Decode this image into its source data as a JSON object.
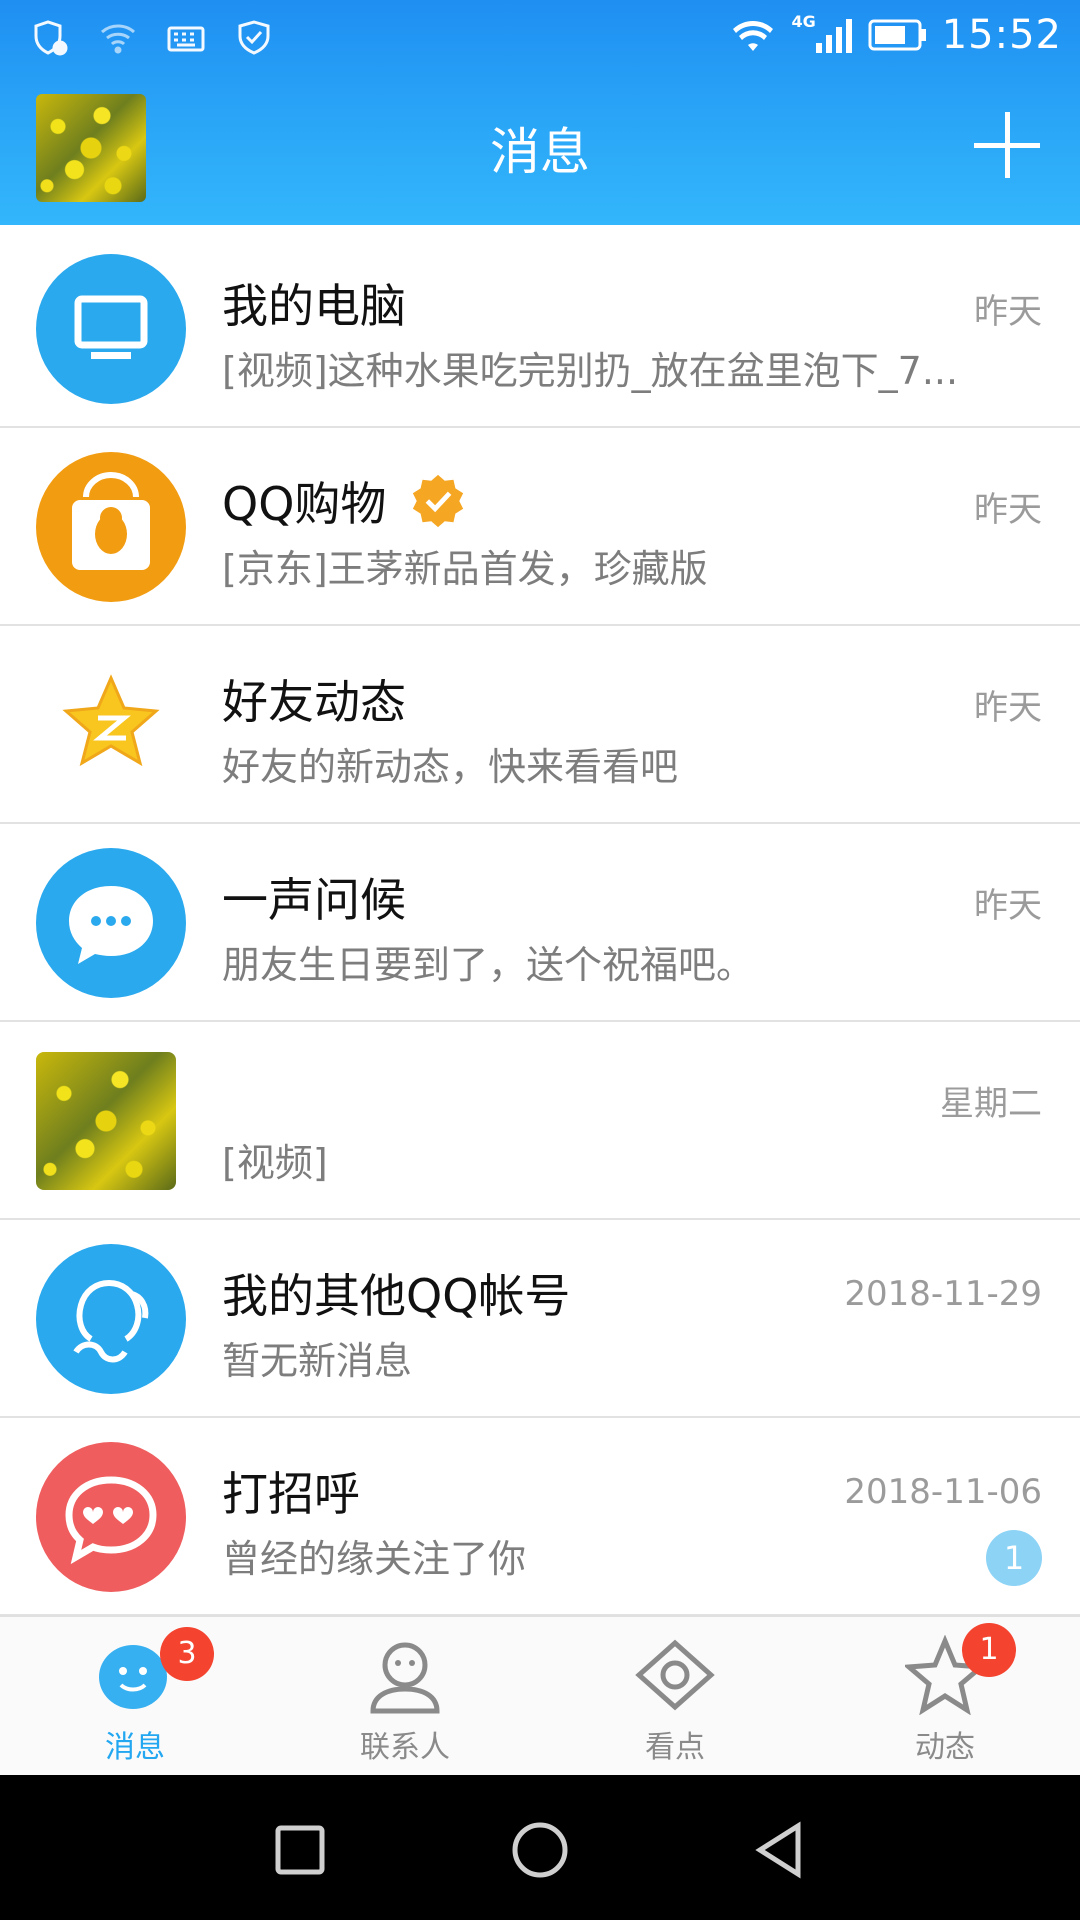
{
  "status_bar": {
    "time": "15:52",
    "network": "4G",
    "icons": [
      "shield-alert-icon",
      "wifi-question-icon",
      "keyboard-icon",
      "shield-check-icon",
      "wifi-icon",
      "signal-icon",
      "battery-icon"
    ]
  },
  "header": {
    "title": "消息",
    "add_icon": "plus-icon"
  },
  "conversations": [
    {
      "name": "我的电脑",
      "message": "[视频]这种水果吃完别扔_放在盆里泡下_7...",
      "time": "昨天",
      "icon": "monitor-icon",
      "color": "#2aa9ee"
    },
    {
      "name": "QQ购物",
      "message": "[京东]王茅新品首发，珍藏版",
      "time": "昨天",
      "icon": "shopping-bag-penguin-icon",
      "color": "#f29c11",
      "verified_icon": "verified-badge-icon"
    },
    {
      "name": "好友动态",
      "message": "好友的新动态，快来看看吧",
      "time": "昨天",
      "icon": "star-icon",
      "color": "#f6c51a"
    },
    {
      "name": "一声问候",
      "message": "朋友生日要到了，送个祝福吧。",
      "time": "昨天",
      "icon": "chat-bubble-icon",
      "color": "#2aa9ee"
    },
    {
      "name": "",
      "message": "[视频]",
      "time": "星期二",
      "icon": "user-avatar",
      "color": ""
    },
    {
      "name": "我的其他QQ帐号",
      "message": "暂无新消息",
      "time": "2018-11-29",
      "icon": "accounts-icon",
      "color": "#2aa9ee"
    },
    {
      "name": "打招呼",
      "message": "曾经的缘关注了你",
      "time": "2018-11-06",
      "icon": "hearts-bubble-icon",
      "color": "#ef5d5e",
      "unread": "1"
    }
  ],
  "tabs": [
    {
      "label": "消息",
      "badge": "3",
      "active": true
    },
    {
      "label": "联系人"
    },
    {
      "label": "看点"
    },
    {
      "label": "动态",
      "badge": "1"
    }
  ],
  "nav": [
    "recent-apps-icon",
    "home-icon",
    "back-icon"
  ]
}
